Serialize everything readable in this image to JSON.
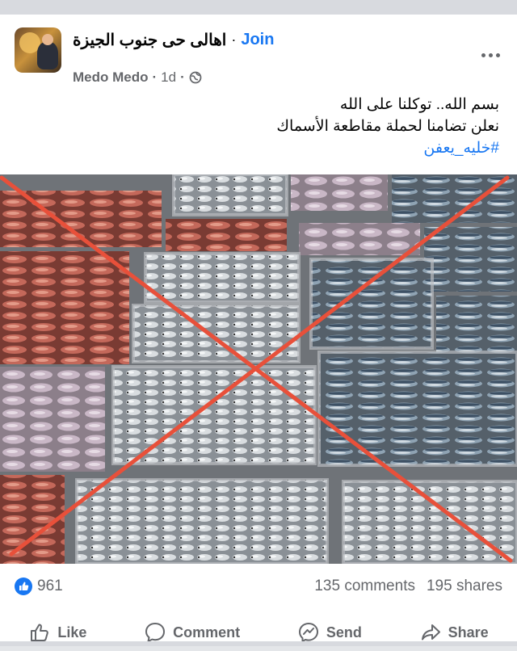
{
  "post": {
    "group_name": "اهالى حى جنوب الجيزة",
    "separator": "·",
    "join_label": "Join",
    "author": "Medo Medo",
    "time": "1d",
    "lines": [
      "بسم الله.. توكلنا على الله",
      "نعلن تضامنا لحملة مقاطعة الأسماك"
    ],
    "hashtag": "#خليه_يعفن"
  },
  "stats": {
    "likes": "961",
    "comments": "135 comments",
    "shares": "195 shares"
  },
  "actions": {
    "like": "Like",
    "comment": "Comment",
    "send": "Send",
    "share": "Share"
  },
  "colors": {
    "accent": "#1877f2",
    "cross": "#e8503a",
    "secondary_text": "#65676b"
  },
  "icons": [
    "more-icon",
    "globe-icon",
    "like-badge-icon",
    "thumbs-up-icon",
    "comment-bubble-icon",
    "messenger-icon",
    "share-arrow-icon"
  ]
}
